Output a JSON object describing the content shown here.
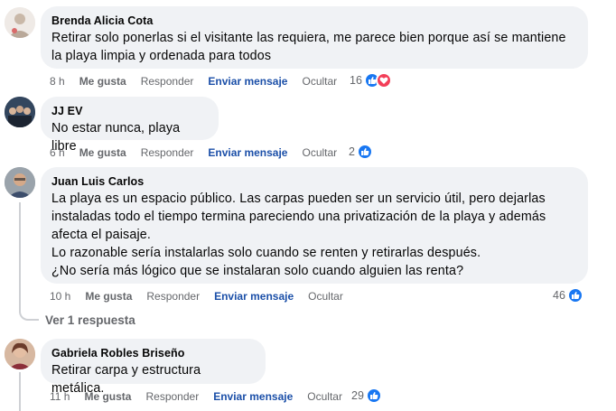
{
  "comments": [
    {
      "author": "Brenda Alicia Cota",
      "lines": [
        "Retirar solo ponerlas si el visitante las requiera, me parece bien porque así se mantiene",
        "la playa limpia y ordenada para todos"
      ],
      "time": "8 h",
      "like_label": "Me gusta",
      "reply_label": "Responder",
      "message_label": "Enviar mensaje",
      "hide_label": "Ocultar",
      "reactions": "16",
      "reaction_types": [
        "like",
        "love"
      ]
    },
    {
      "author": "JJ EV",
      "lines": [
        "No estar nunca, playa libre"
      ],
      "time": "6 h",
      "like_label": "Me gusta",
      "reply_label": "Responder",
      "message_label": "Enviar mensaje",
      "hide_label": "Ocultar",
      "reactions": "2",
      "reaction_types": [
        "like"
      ]
    },
    {
      "author": "Juan Luis Carlos",
      "lines": [
        "La playa es un espacio público. Las carpas pueden ser un servicio útil, pero dejarlas",
        "instaladas todo el tiempo termina pareciendo una privatización de la playa y además",
        "afecta el paisaje.",
        "Lo razonable sería instalarlas solo cuando se renten y retirarlas después.",
        "¿No sería más lógico que se instalaran solo cuando alguien las renta?"
      ],
      "time": "10 h",
      "like_label": "Me gusta",
      "reply_label": "Responder",
      "message_label": "Enviar mensaje",
      "hide_label": "Ocultar",
      "reactions": "46",
      "reaction_types": [
        "like"
      ],
      "view_replies": "Ver 1 respuesta"
    },
    {
      "author": "Gabriela Robles Briseño",
      "lines": [
        "Retirar carpa y estructura metálica."
      ],
      "time": "11 h",
      "like_label": "Me gusta",
      "reply_label": "Responder",
      "message_label": "Enviar mensaje",
      "hide_label": "Ocultar",
      "reactions": "29",
      "reaction_types": [
        "like"
      ]
    }
  ],
  "colors": {
    "bubble": "#f0f2f5",
    "meta_text": "#65676b",
    "send_message": "#1b4fa8",
    "like_blue": "#1877f2",
    "love_red": "#f33e58"
  }
}
